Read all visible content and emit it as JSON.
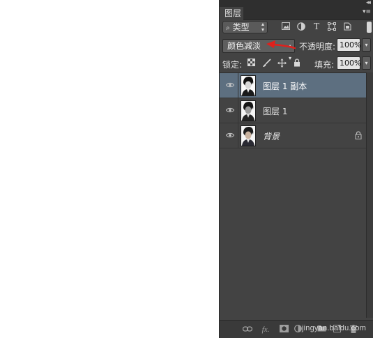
{
  "panel": {
    "tab_label": "图层",
    "collapse_glyph": "◂◂",
    "menu_glyph": "▾≡"
  },
  "filter": {
    "kind_label": "类型",
    "icons": [
      "image-filter-icon",
      "adjustment-filter-icon",
      "type-filter-icon",
      "shape-filter-icon",
      "smart-object-filter-icon"
    ]
  },
  "blend": {
    "mode": "颜色减淡",
    "opacity_label": "不透明度:",
    "opacity_value": "100%"
  },
  "lock": {
    "label": "锁定:",
    "fill_label": "填充:",
    "fill_value": "100%"
  },
  "layers": [
    {
      "name": "图层 1 副本",
      "selected": true,
      "locked": false
    },
    {
      "name": "图层 1",
      "selected": false,
      "locked": false
    },
    {
      "name": "背景",
      "selected": false,
      "locked": true
    }
  ],
  "footer": {
    "watermark": "jingyan.baidu.com"
  },
  "colors": {
    "panel_bg": "#434343",
    "selected_layer": "#5d6f80",
    "annotation_arrow": "#e0201c"
  }
}
